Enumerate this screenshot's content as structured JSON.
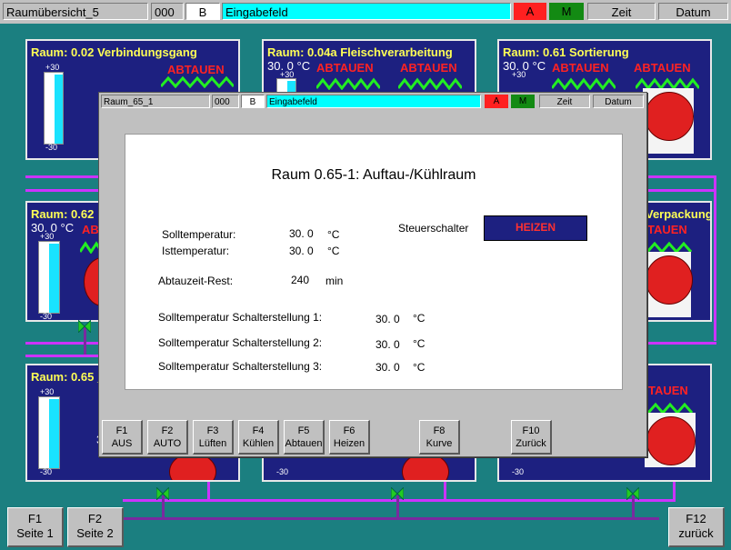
{
  "topbar": {
    "title": "Raumübersicht_5",
    "code": "000",
    "mode": "B",
    "input": "Eingabefeld",
    "alarm": "A",
    "manual": "M",
    "time": "Zeit",
    "date": "Datum"
  },
  "rooms": [
    {
      "title": "Raum: 0.02 Verbindungsgang",
      "status": "ABTAUEN",
      "scale_max": "+30",
      "scale_min": "-30"
    },
    {
      "title": "Raum: 0.04a Fleischverarbeitung",
      "temp": "30. 0 °C",
      "status": "ABTAUEN",
      "status2": "ABTAUEN",
      "scale_max": "+30"
    },
    {
      "title": "Raum: 0.61 Sortierung",
      "temp": "30. 0 °C",
      "status": "ABTAUEN",
      "status2": "ABTAUEN",
      "scale_max": "+30"
    },
    {
      "title": "Raum: 0.62 :",
      "temp": "30. 0 °C",
      "status": "ABT",
      "scale_max": "+30",
      "scale_min": "-30"
    },
    {
      "title": "Verpackung",
      "status": "TAUEN"
    },
    {
      "title": "Raum: 0.65 _",
      "scale_max": "+30",
      "scale_min": "-30",
      "partial": "3"
    },
    {
      "scale_min": "-30"
    },
    {
      "status": "TAUEN",
      "scale_min": "-30"
    }
  ],
  "popup": {
    "title": "Raum_65_1",
    "code": "000",
    "mode": "B",
    "input": "Eingabefeld",
    "alarm": "A",
    "manual": "M",
    "time": "Zeit",
    "date": "Datum",
    "heading": "Raum 0.65-1: Auftau-/Kühlraum",
    "soll_label": "Solltemperatur:",
    "soll_value": "30. 0",
    "soll_unit": "°C",
    "ist_label": "Isttemperatur:",
    "ist_value": "30. 0",
    "ist_unit": "°C",
    "abtau_label": "Abtauzeit-Rest:",
    "abtau_value": "240",
    "abtau_unit": "min",
    "switch_label": "Steuerschalter",
    "switch_value": "HEIZEN",
    "s1_label": "Solltemperatur Schalterstellung 1:",
    "s1_value": "30. 0",
    "s1_unit": "°C",
    "s2_label": "Solltemperatur Schalterstellung 2:",
    "s2_value": "30. 0",
    "s2_unit": "°C",
    "s3_label": "Solltemperatur Schalterstellung 3:",
    "s3_value": "30. 0",
    "s3_unit": "°C",
    "fkeys": [
      {
        "key": "F1",
        "label": "AUS"
      },
      {
        "key": "F2",
        "label": "AUTO"
      },
      {
        "key": "F3",
        "label": "Lüften"
      },
      {
        "key": "F4",
        "label": "Kühlen"
      },
      {
        "key": "F5",
        "label": "Abtauen"
      },
      {
        "key": "F6",
        "label": "Heizen"
      },
      {
        "key": "F8",
        "label": "Kurve"
      },
      {
        "key": "F10",
        "label": "Zurück"
      }
    ]
  },
  "bottom": {
    "f1_key": "F1",
    "f1_label": "Seite 1",
    "f2_key": "F2",
    "f2_label": "Seite 2",
    "f12_key": "F12",
    "f12_label": "zurück"
  },
  "colors": {
    "background": "#1b7f80",
    "room_panel": "#1d2080",
    "title_yellow": "#ffff55",
    "status_red": "#ff2222",
    "gauge_cyan": "#19e3ff",
    "pipe_magenta": "#cc33ff",
    "input_cyan": "#00ffff",
    "alarm_red": "#ff2020",
    "manual_green": "#138a13"
  }
}
